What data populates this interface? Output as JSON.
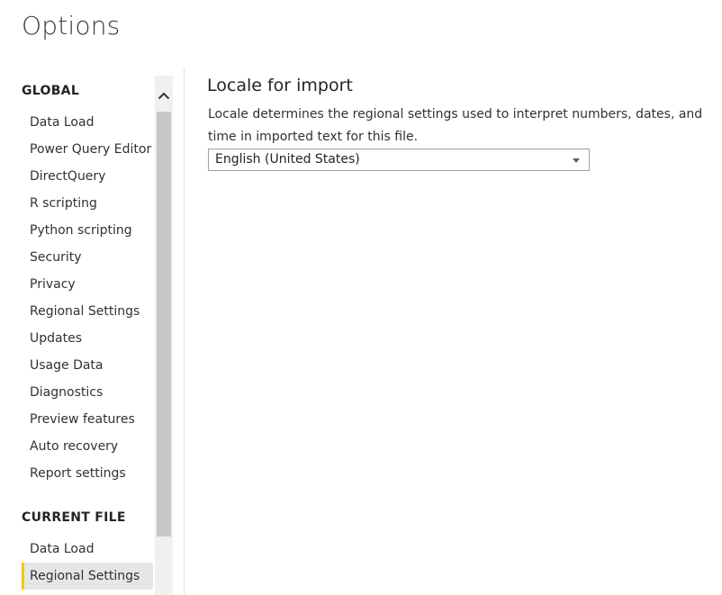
{
  "page": {
    "title": "Options"
  },
  "sidebar": {
    "global_header": "GLOBAL",
    "global_items": [
      {
        "label": "Data Load"
      },
      {
        "label": "Power Query Editor"
      },
      {
        "label": "DirectQuery"
      },
      {
        "label": "R scripting"
      },
      {
        "label": "Python scripting"
      },
      {
        "label": "Security"
      },
      {
        "label": "Privacy"
      },
      {
        "label": "Regional Settings"
      },
      {
        "label": "Updates"
      },
      {
        "label": "Usage Data"
      },
      {
        "label": "Diagnostics"
      },
      {
        "label": "Preview features"
      },
      {
        "label": "Auto recovery"
      },
      {
        "label": "Report settings"
      }
    ],
    "current_file_header": "CURRENT FILE",
    "current_file_items": [
      {
        "label": "Data Load"
      },
      {
        "label": "Regional Settings",
        "selected": true
      }
    ],
    "scroll_up_icon": "chevron-up-icon"
  },
  "content": {
    "title": "Locale for import",
    "description": "Locale determines the regional settings used to interpret numbers, dates, and time in imported text for this file.",
    "locale_select": {
      "value": "English (United States)",
      "caret_icon": "caret-down-icon"
    }
  },
  "colors": {
    "selected_accent": "#f2c811",
    "selected_background": "#e6e6e6",
    "scrollbar_track": "#f0f0f0",
    "scrollbar_thumb": "#c8c8c8"
  }
}
